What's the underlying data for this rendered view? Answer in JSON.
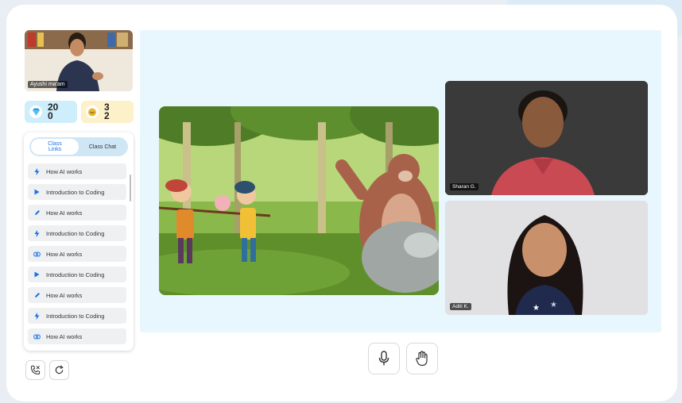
{
  "teacher": {
    "name": "Ayushi ma'am"
  },
  "stats": {
    "gems": "20\n0",
    "gems_l1": "20",
    "gems_l2": "0",
    "coins_l1": "3",
    "coins_l2": "2"
  },
  "tabs": [
    {
      "label": "Class\nLinks"
    },
    {
      "label": "Class Chat"
    }
  ],
  "tab0_l1": "Class",
  "tab0_l2": "Links",
  "links": [
    {
      "label": "How AI works",
      "icon": "bolt-icon"
    },
    {
      "label": "Introduction to Coding",
      "icon": "play-icon"
    },
    {
      "label": "How AI works",
      "icon": "pencil-icon"
    },
    {
      "label": "Introduction to Coding",
      "icon": "bolt-icon"
    },
    {
      "label": "How AI works",
      "icon": "link-icon"
    },
    {
      "label": "Introduction to Coding",
      "icon": "play-icon"
    },
    {
      "label": "How AI works",
      "icon": "pencil-icon"
    },
    {
      "label": "Introduction to Coding",
      "icon": "bolt-icon"
    },
    {
      "label": "How AI works",
      "icon": "link-icon"
    }
  ],
  "participants": [
    {
      "name": "Sharan G."
    },
    {
      "name": "Aditi K."
    }
  ],
  "colors": {
    "accent": "#1a73e8",
    "stage_bg": "#e8f6fd"
  }
}
